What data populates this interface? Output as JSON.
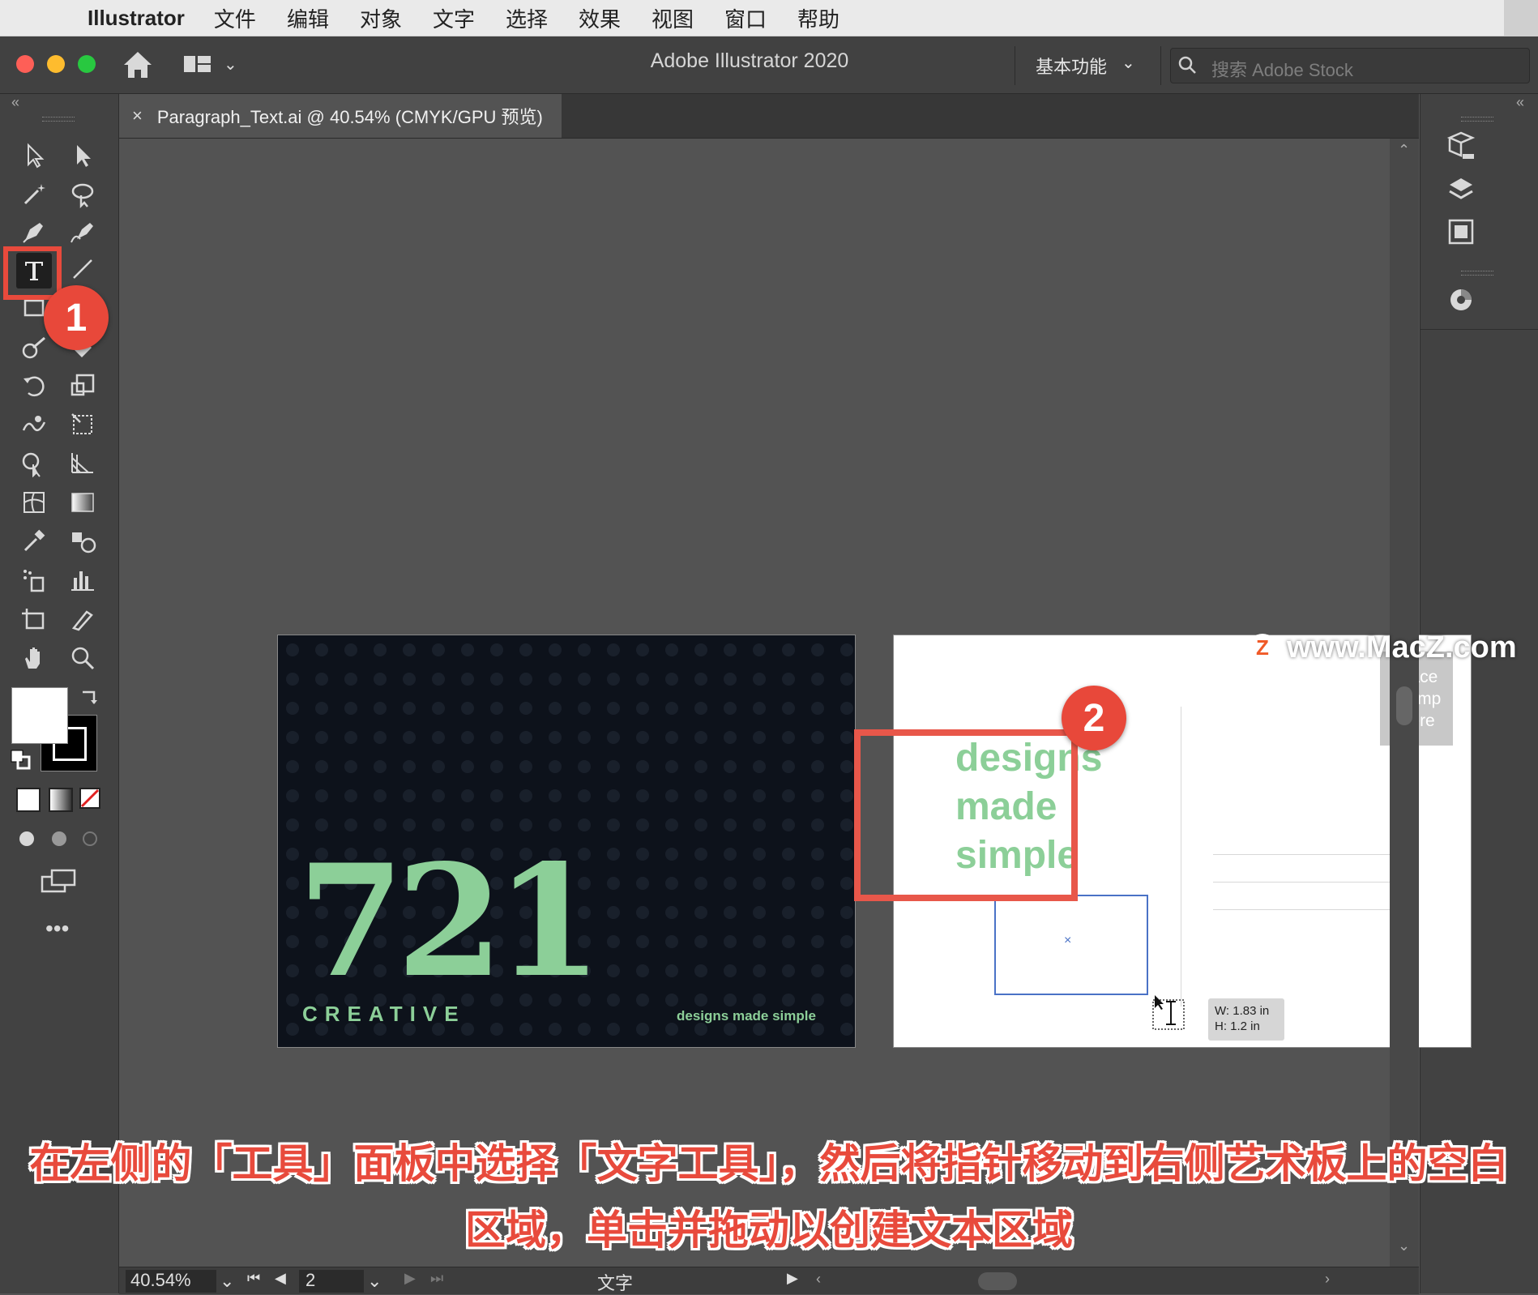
{
  "menubar": {
    "app_name": "Illustrator",
    "items": [
      "文件",
      "编辑",
      "对象",
      "文字",
      "选择",
      "效果",
      "视图",
      "窗口",
      "帮助"
    ]
  },
  "titlebar": {
    "app_title": "Adobe Illustrator 2020",
    "workspace": "基本功能",
    "search_placeholder": "搜索 Adobe Stock"
  },
  "document": {
    "tab_title": "Paragraph_Text.ai @ 40.54% (CMYK/GPU 预览)",
    "close_glyph": "×"
  },
  "artboard_front": {
    "number": "721",
    "brand": "CREATIVE",
    "tagline": "designs made simple"
  },
  "artboard_back": {
    "headline_lines": [
      "designs",
      "made",
      "simple"
    ],
    "stamp_text": "Place\nStamp\nHere",
    "text_frame_center": "×",
    "dimension_w": "W: 1.83 in",
    "dimension_h": "H: 1.2 in"
  },
  "annotations": {
    "badge1": "1",
    "badge2": "2",
    "watermark": "www.MacZ.com",
    "watermark_logo": "Z",
    "caption_line1": "在左侧的「工具」面板中选择「文字工具」，然后将指针移动到右侧艺术板上的空白",
    "caption_line2": "区域，单击并拖动以创建文本区域"
  },
  "statusbar": {
    "zoom": "40.54%",
    "page": "2",
    "current_tool": "文字"
  },
  "colors": {
    "accent_green": "#8ccf98",
    "annotation_red": "#e84a3c",
    "frame_blue": "#4a72c6"
  },
  "icons": {
    "tools": [
      "selection-tool",
      "direct-selection-tool",
      "magic-wand-tool",
      "lasso-tool",
      "pen-tool",
      "curvature-tool",
      "type-tool",
      "line-segment-tool",
      "rectangle-tool",
      "paintbrush-tool",
      "shaper-tool",
      "eraser-tool",
      "rotate-tool",
      "scale-tool",
      "warp-tool",
      "free-transform-tool",
      "shape-builder-tool",
      "perspective-grid-tool",
      "mesh-tool",
      "gradient-tool",
      "eyedropper-tool",
      "blend-tool",
      "symbol-sprayer-tool",
      "column-graph-tool",
      "artboard-tool",
      "slice-tool",
      "hand-tool",
      "zoom-tool"
    ],
    "right_panel": [
      "libraries-icon",
      "layers-icon",
      "artboards-icon",
      "color-themes-icon"
    ]
  }
}
